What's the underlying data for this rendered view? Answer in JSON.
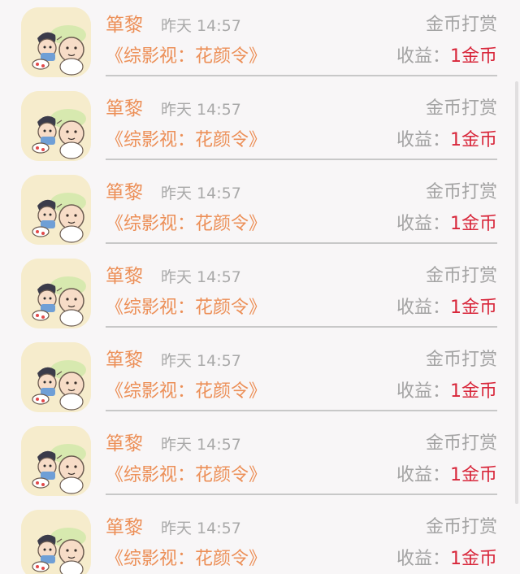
{
  "colors": {
    "accent_orange": "#ec8f57",
    "gray_text": "#a3a3a3",
    "reward_red": "#d8263a",
    "background": "#f8f6f7"
  },
  "rows": [
    {
      "name": "箪黎",
      "time": "昨天 14:57",
      "action": "金币打赏",
      "book": "《综影视：花颜令》",
      "earn_label": "收益：",
      "earn_value": "1金币",
      "avatar_icon": "cartoon-kids-avatar"
    },
    {
      "name": "箪黎",
      "time": "昨天 14:57",
      "action": "金币打赏",
      "book": "《综影视：花颜令》",
      "earn_label": "收益：",
      "earn_value": "1金币",
      "avatar_icon": "cartoon-kids-avatar"
    },
    {
      "name": "箪黎",
      "time": "昨天 14:57",
      "action": "金币打赏",
      "book": "《综影视：花颜令》",
      "earn_label": "收益：",
      "earn_value": "1金币",
      "avatar_icon": "cartoon-kids-avatar"
    },
    {
      "name": "箪黎",
      "time": "昨天 14:57",
      "action": "金币打赏",
      "book": "《综影视：花颜令》",
      "earn_label": "收益：",
      "earn_value": "1金币",
      "avatar_icon": "cartoon-kids-avatar"
    },
    {
      "name": "箪黎",
      "time": "昨天 14:57",
      "action": "金币打赏",
      "book": "《综影视：花颜令》",
      "earn_label": "收益：",
      "earn_value": "1金币",
      "avatar_icon": "cartoon-kids-avatar"
    },
    {
      "name": "箪黎",
      "time": "昨天 14:57",
      "action": "金币打赏",
      "book": "《综影视：花颜令》",
      "earn_label": "收益：",
      "earn_value": "1金币",
      "avatar_icon": "cartoon-kids-avatar"
    },
    {
      "name": "箪黎",
      "time": "昨天 14:57",
      "action": "金币打赏",
      "book": "《综影视：花颜令》",
      "earn_label": "收益：",
      "earn_value": "1金币",
      "avatar_icon": "cartoon-kids-avatar"
    }
  ]
}
